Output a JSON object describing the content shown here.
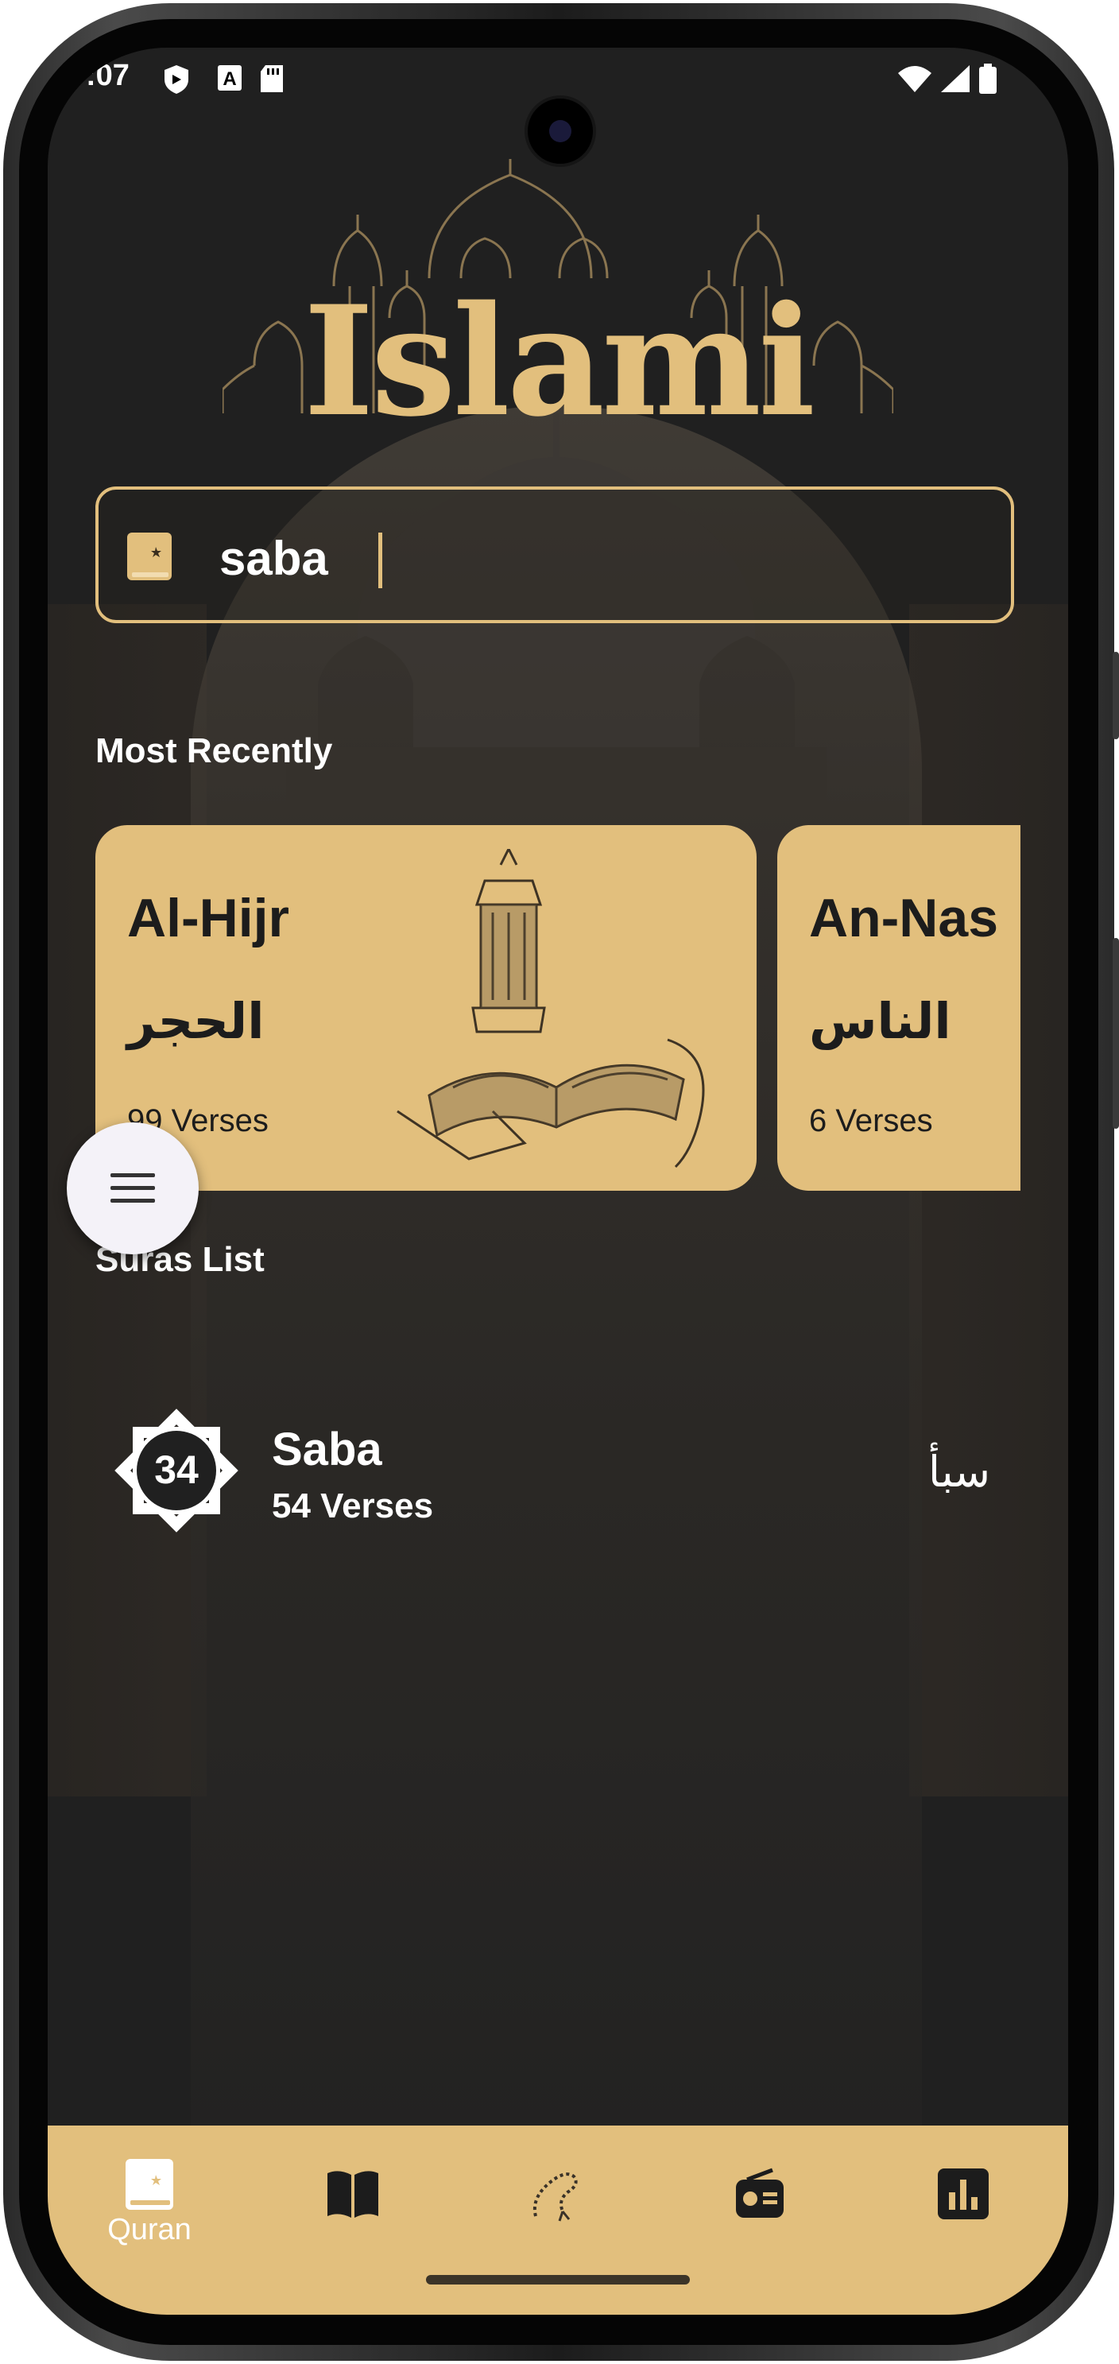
{
  "status_bar": {
    "time": ":07",
    "icons": [
      "shield-icon",
      "a-icon",
      "sd-card-icon",
      "wifi-icon",
      "signal-icon",
      "battery-icon"
    ]
  },
  "app": {
    "logo_text": "Islami",
    "accent_color": "#e2bf7d",
    "background_color": "#202020"
  },
  "search": {
    "value": "saba",
    "icon": "quran-book-icon"
  },
  "most_recent": {
    "title": "Most Recently",
    "cards": [
      {
        "name_en": "Al-Hijr",
        "name_ar": "الحجر",
        "verses": "99 Verses"
      },
      {
        "name_en": "An-Nas",
        "name_ar": "الناس",
        "verses": "6 Verses"
      }
    ]
  },
  "suras_list": {
    "title": "Suras List",
    "items": [
      {
        "number": "34",
        "name_en": "Saba",
        "verses": "54 Verses",
        "name_ar": "سبأ"
      }
    ]
  },
  "bottom_nav": {
    "items": [
      {
        "icon": "quran-icon",
        "label": "Quran",
        "active": true
      },
      {
        "icon": "book-icon",
        "label": "",
        "active": false
      },
      {
        "icon": "sebha-icon",
        "label": "",
        "active": false
      },
      {
        "icon": "radio-icon",
        "label": "",
        "active": false
      },
      {
        "icon": "time-chart-icon",
        "label": "",
        "active": false
      }
    ]
  }
}
